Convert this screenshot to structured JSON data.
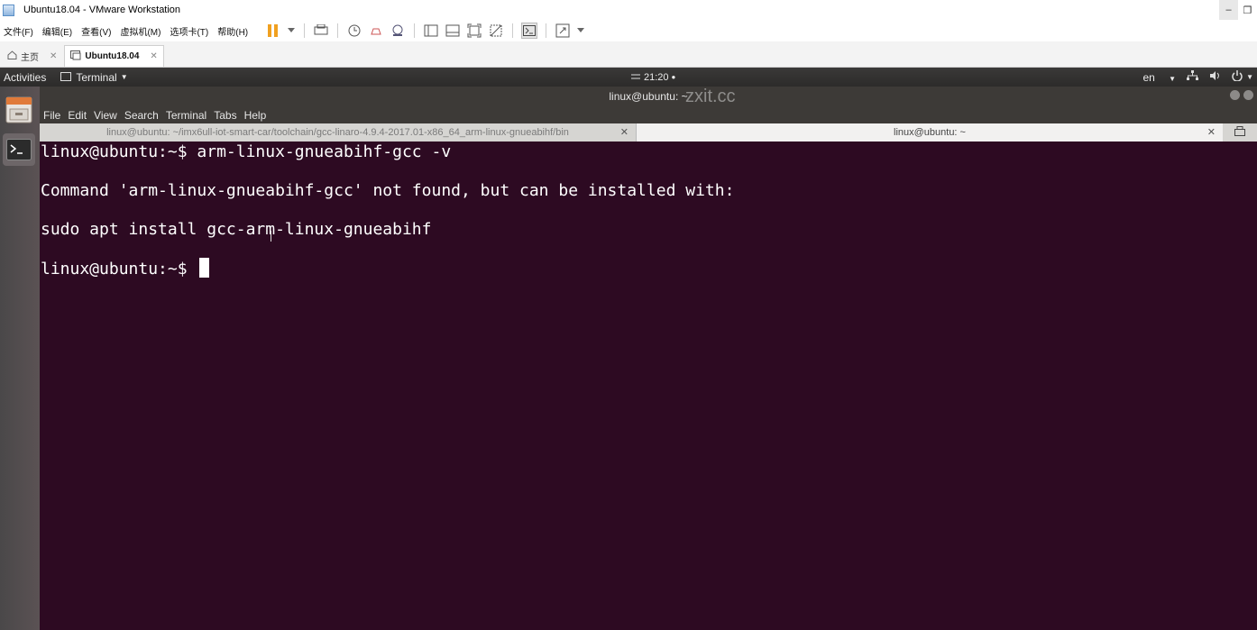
{
  "vmware": {
    "title": "Ubuntu18.04 - VMware Workstation",
    "menu": [
      "文件(F)",
      "编辑(E)",
      "查看(V)",
      "虚拟机(M)",
      "选项卡(T)",
      "帮助(H)"
    ],
    "tabs": [
      {
        "label": "主页"
      },
      {
        "label": "Ubuntu18.04"
      }
    ]
  },
  "ubuntu_topbar": {
    "activities": "Activities",
    "app_menu": "Terminal",
    "clock": "21:20",
    "lang": "en"
  },
  "terminal": {
    "window_title": "linux@ubuntu: ~",
    "watermark": "zxit.cc",
    "menu": [
      "File",
      "Edit",
      "View",
      "Search",
      "Terminal",
      "Tabs",
      "Help"
    ],
    "tabs": [
      {
        "label": "linux@ubuntu: ~/imx6ull-iot-smart-car/toolchain/gcc-linaro-4.9.4-2017.01-x86_64_arm-linux-gnueabihf/bin"
      },
      {
        "label": "linux@ubuntu: ~"
      }
    ],
    "lines": [
      "linux@ubuntu:~$ arm-linux-gnueabihf-gcc -v",
      "Command 'arm-linux-gnueabihf-gcc' not found, but can be installed with:",
      "sudo apt install gcc-arm-linux-gnueabihf",
      "linux@ubuntu:~$ "
    ]
  },
  "colors": {
    "terminal_bg": "#2d0a22",
    "topbar_bg": "#2c2b2a",
    "accent_orange": "#f0a020"
  }
}
